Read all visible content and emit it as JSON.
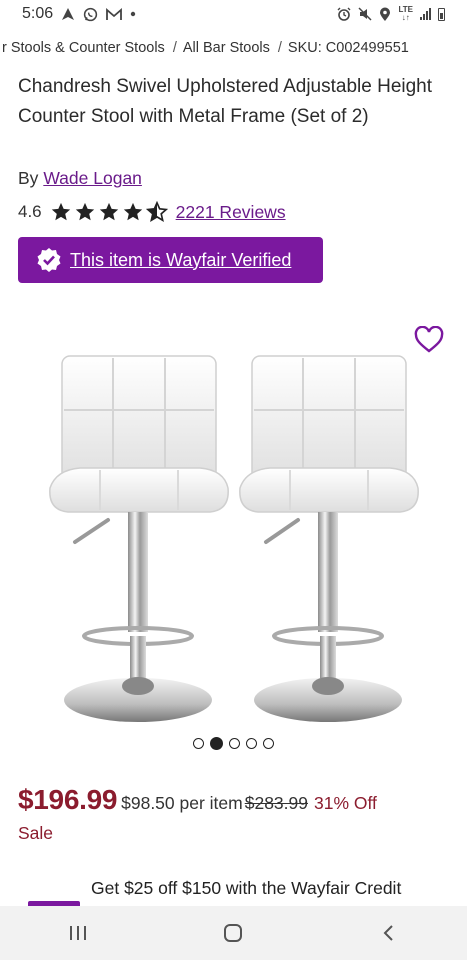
{
  "status_bar": {
    "time": "5:06",
    "left_icons": [
      "navigation-icon",
      "whatsapp-icon",
      "gmail-icon",
      "dot-icon"
    ],
    "right_icons": [
      "alarm-icon",
      "mute-icon",
      "location-icon",
      "lte-icon",
      "signal-icon",
      "battery-icon"
    ],
    "lte_label": "LTE"
  },
  "breadcrumb": {
    "items": [
      "r Stools & Counter Stools",
      "All Bar Stools",
      "SKU: C002499551"
    ],
    "separator": "/"
  },
  "product": {
    "title": "Chandresh Swivel Upholstered Adjustable Height Counter Stool with Metal Frame (Set of 2)",
    "by_prefix": "By",
    "brand": "Wade Logan",
    "rating_value": "4.6",
    "rating_stars": 4.6,
    "reviews_label": "2221 Reviews",
    "verified_label": "This item is Wayfair Verified"
  },
  "gallery": {
    "image_count": 5,
    "active_index": 1
  },
  "pricing": {
    "price": "$196.99",
    "per_item": "$98.50 per item",
    "was_price": "$283.99",
    "discount": "31% Off",
    "sale_label": "Sale"
  },
  "promo": {
    "text": "Get $25 off $150 with the Wayfair Credit"
  },
  "colors": {
    "brand_purple": "#7b189f",
    "link_purple": "#6a1b8a",
    "price_red": "#8b1c2e"
  },
  "nav_bar": {
    "icons": [
      "recent-apps-icon",
      "home-icon",
      "back-icon"
    ]
  }
}
